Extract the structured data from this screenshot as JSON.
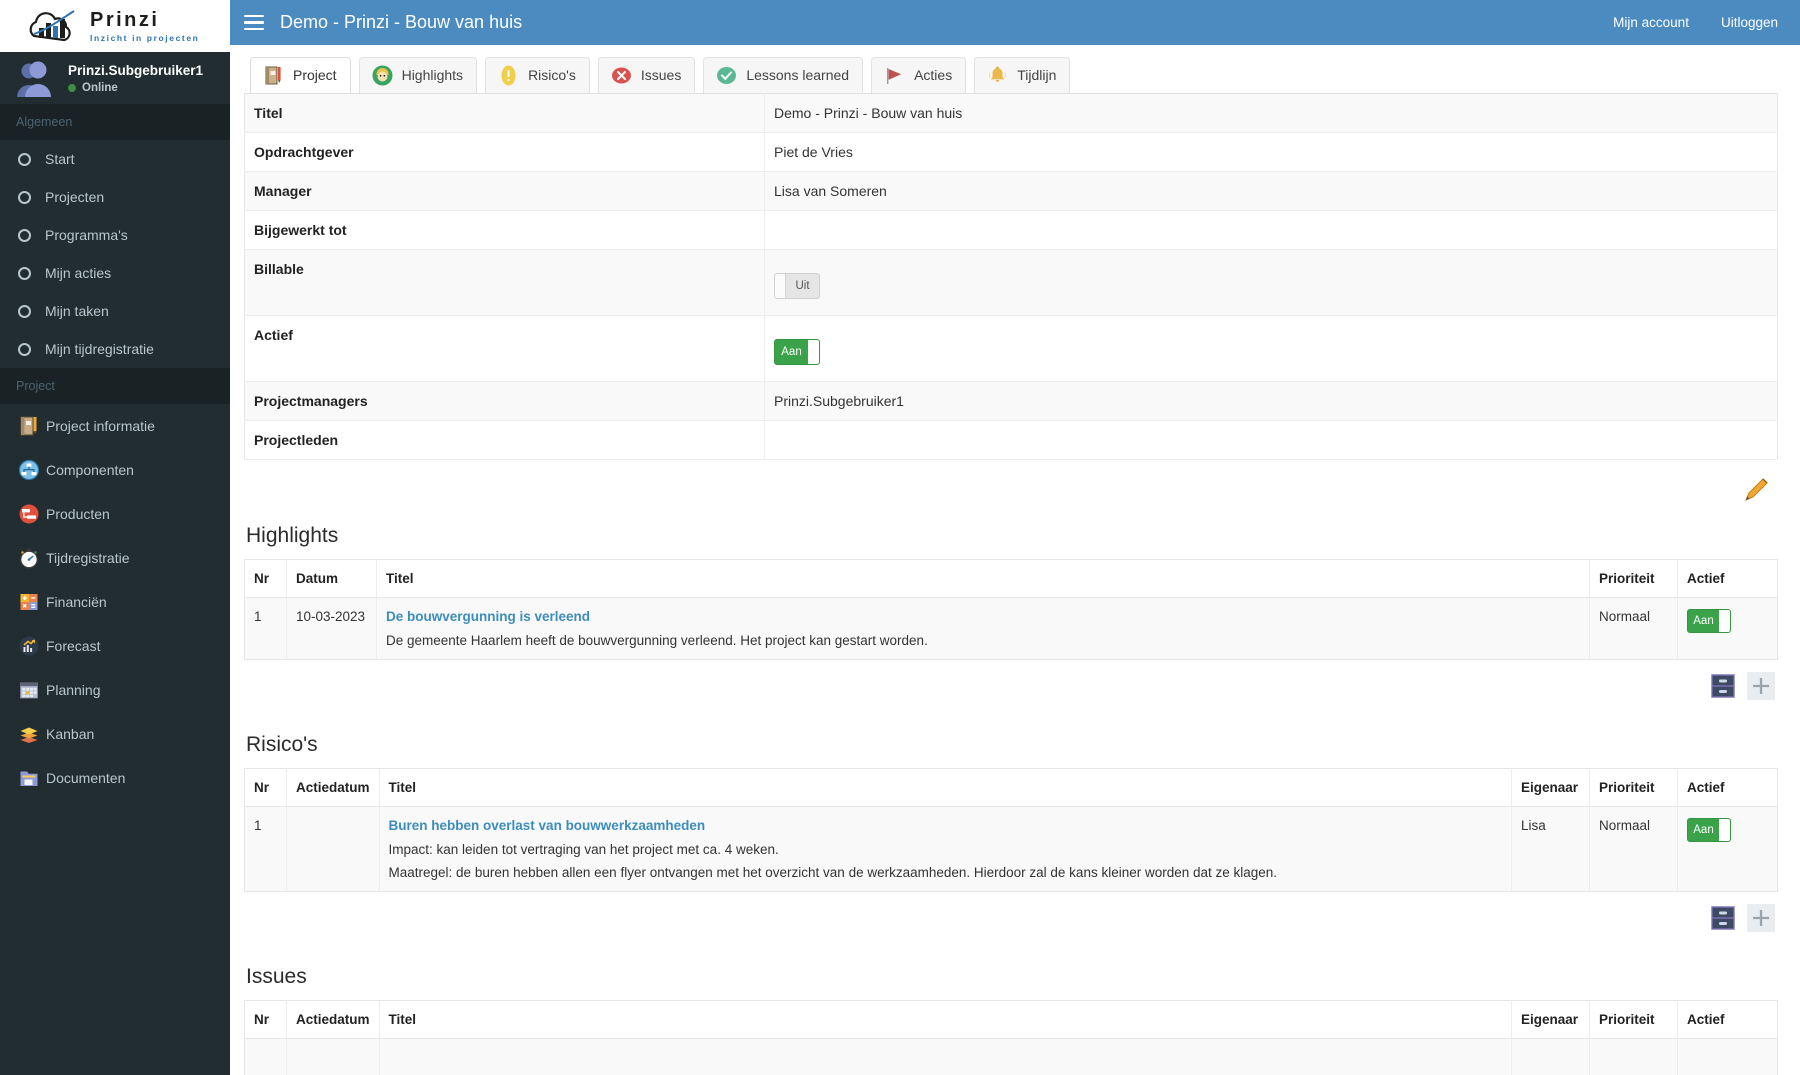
{
  "brand": {
    "name": "Prinzi",
    "tagline": "Inzicht in projecten",
    "logo_icon": "prinzi-cloud-chart-logo"
  },
  "topbar": {
    "menu_icon": "hamburger-icon",
    "title": "Demo - Prinzi - Bouw van huis",
    "account_label": "Mijn account",
    "logout_label": "Uitloggen",
    "bg_color": "#4b8bc0"
  },
  "sidebar": {
    "user": {
      "name": "Prinzi.Subgebruiker1",
      "status": "Online",
      "status_color": "#3c8f3c",
      "avatar_icon": "user-avatar-icon"
    },
    "groups": [
      {
        "header": "Algemeen",
        "items": [
          {
            "label": "Start",
            "icon": "circle-icon"
          },
          {
            "label": "Projecten",
            "icon": "circle-icon"
          },
          {
            "label": "Programma's",
            "icon": "circle-icon"
          },
          {
            "label": "Mijn acties",
            "icon": "circle-icon"
          },
          {
            "label": "Mijn taken",
            "icon": "circle-icon"
          },
          {
            "label": "Mijn tijdregistratie",
            "icon": "circle-icon"
          }
        ]
      },
      {
        "header": "Project",
        "items": [
          {
            "label": "Project informatie",
            "icon": "notebook-pencil-icon"
          },
          {
            "label": "Componenten",
            "icon": "network-globe-icon"
          },
          {
            "label": "Producten",
            "icon": "hierarchy-red-icon"
          },
          {
            "label": "Tijdregistratie",
            "icon": "stopwatch-icon"
          },
          {
            "label": "Financiën",
            "icon": "calculator-icon"
          },
          {
            "label": "Forecast",
            "icon": "chart-trend-icon"
          },
          {
            "label": "Planning",
            "icon": "calendar-icon"
          },
          {
            "label": "Kanban",
            "icon": "stacked-layers-icon"
          },
          {
            "label": "Documenten",
            "icon": "folder-icon"
          }
        ]
      }
    ]
  },
  "tabs": [
    {
      "label": "Project",
      "icon": "notebook-pencil-icon",
      "active": true
    },
    {
      "label": "Highlights",
      "icon": "green-avatar-icon",
      "active": false
    },
    {
      "label": "Risico's",
      "icon": "yellow-warning-icon",
      "active": false
    },
    {
      "label": "Issues",
      "icon": "red-x-icon",
      "active": false
    },
    {
      "label": "Lessons learned",
      "icon": "green-check-icon",
      "active": false
    },
    {
      "label": "Acties",
      "icon": "red-flag-icon",
      "active": false
    },
    {
      "label": "Tijdlijn",
      "icon": "bell-icon",
      "active": false
    }
  ],
  "project_info": {
    "rows": [
      {
        "label": "Titel",
        "value": "Demo - Prinzi - Bouw van huis",
        "type": "text"
      },
      {
        "label": "Opdrachtgever",
        "value": "Piet de Vries",
        "type": "text"
      },
      {
        "label": "Manager",
        "value": "Lisa van Someren",
        "type": "text"
      },
      {
        "label": "Bijgewerkt tot",
        "value": "",
        "type": "text"
      },
      {
        "label": "Billable",
        "value": "Uit",
        "type": "toggle",
        "state": "off"
      },
      {
        "label": "Actief",
        "value": "Aan",
        "type": "toggle",
        "state": "on"
      },
      {
        "label": "Projectmanagers",
        "value": "Prinzi.Subgebruiker1",
        "type": "text"
      },
      {
        "label": "Projectleden",
        "value": "",
        "type": "text"
      }
    ],
    "edit_icon": "pencil-edit-icon"
  },
  "sections": [
    {
      "title": "Highlights",
      "columns": [
        "Nr",
        "Datum",
        "Titel",
        "Prioriteit",
        "Actief"
      ],
      "column_kinds": [
        "nr",
        "date",
        "title",
        "prio",
        "act"
      ],
      "rows": [
        {
          "nr": "1",
          "date": "10-03-2023",
          "title": "De bouwvergunning is verleend",
          "lines": [
            "De gemeente Haarlem heeft de bouwvergunning verleend. Het project kan gestart worden."
          ],
          "owner": "",
          "prio": "Normaal",
          "active_label": "Aan",
          "active_state": "on"
        }
      ],
      "actions": [
        {
          "icon": "archive-cabinet-icon",
          "name": "archive-button"
        },
        {
          "icon": "plus-icon",
          "name": "add-button"
        }
      ]
    },
    {
      "title": "Risico's",
      "columns": [
        "Nr",
        "Actiedatum",
        "Titel",
        "Eigenaar",
        "Prioriteit",
        "Actief"
      ],
      "column_kinds": [
        "nr",
        "date",
        "title",
        "owner",
        "prio",
        "act"
      ],
      "rows": [
        {
          "nr": "1",
          "date": "",
          "title": "Buren hebben overlast van bouwwerkzaamheden",
          "lines": [
            "Impact: kan leiden tot vertraging van het project met ca. 4 weken.",
            "Maatregel: de buren hebben allen een flyer ontvangen met het overzicht van de werkzaamheden. Hierdoor zal de kans kleiner worden dat ze klagen."
          ],
          "owner": "Lisa",
          "prio": "Normaal",
          "active_label": "Aan",
          "active_state": "on"
        }
      ],
      "actions": [
        {
          "icon": "archive-cabinet-icon",
          "name": "archive-button"
        },
        {
          "icon": "plus-icon",
          "name": "add-button"
        }
      ]
    },
    {
      "title": "Issues",
      "columns": [
        "Nr",
        "Actiedatum",
        "Titel",
        "Eigenaar",
        "Prioriteit",
        "Actief"
      ],
      "column_kinds": [
        "nr",
        "date",
        "title",
        "owner",
        "prio",
        "act"
      ],
      "rows": [],
      "actions": []
    }
  ],
  "colors": {
    "accent_blue": "#3c8dbc",
    "sidebar_bg": "#222d32",
    "toggle_on": "#3aa34a",
    "link": "#3c8dbc"
  }
}
